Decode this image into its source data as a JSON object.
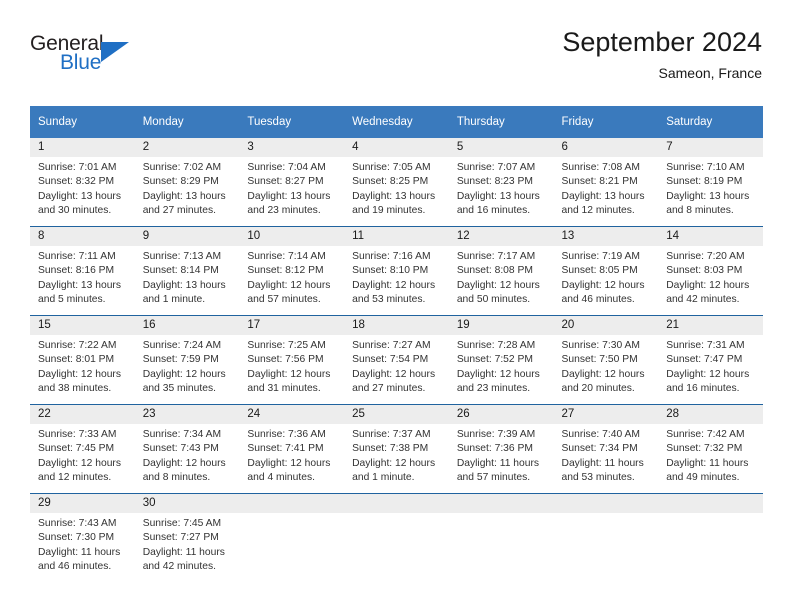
{
  "brand": {
    "name_top": "General",
    "name_bottom": "Blue",
    "color_primary": "#1f6fc4",
    "color_text": "#231f20",
    "triangle_icon": "triangle-icon"
  },
  "header": {
    "title": "September 2024",
    "subtitle": "Sameon, France"
  },
  "colors": {
    "header_row_bg": "#3a7abd",
    "daynum_band_bg": "#ededed",
    "row_separator": "#20639f",
    "page_bg": "#ffffff"
  },
  "weekdays": [
    "Sunday",
    "Monday",
    "Tuesday",
    "Wednesday",
    "Thursday",
    "Friday",
    "Saturday"
  ],
  "weeks": [
    [
      {
        "day": "1",
        "sunrise": "Sunrise: 7:01 AM",
        "sunset": "Sunset: 8:32 PM",
        "daylight_line1": "Daylight: 13 hours",
        "daylight_line2": "and 30 minutes."
      },
      {
        "day": "2",
        "sunrise": "Sunrise: 7:02 AM",
        "sunset": "Sunset: 8:29 PM",
        "daylight_line1": "Daylight: 13 hours",
        "daylight_line2": "and 27 minutes."
      },
      {
        "day": "3",
        "sunrise": "Sunrise: 7:04 AM",
        "sunset": "Sunset: 8:27 PM",
        "daylight_line1": "Daylight: 13 hours",
        "daylight_line2": "and 23 minutes."
      },
      {
        "day": "4",
        "sunrise": "Sunrise: 7:05 AM",
        "sunset": "Sunset: 8:25 PM",
        "daylight_line1": "Daylight: 13 hours",
        "daylight_line2": "and 19 minutes."
      },
      {
        "day": "5",
        "sunrise": "Sunrise: 7:07 AM",
        "sunset": "Sunset: 8:23 PM",
        "daylight_line1": "Daylight: 13 hours",
        "daylight_line2": "and 16 minutes."
      },
      {
        "day": "6",
        "sunrise": "Sunrise: 7:08 AM",
        "sunset": "Sunset: 8:21 PM",
        "daylight_line1": "Daylight: 13 hours",
        "daylight_line2": "and 12 minutes."
      },
      {
        "day": "7",
        "sunrise": "Sunrise: 7:10 AM",
        "sunset": "Sunset: 8:19 PM",
        "daylight_line1": "Daylight: 13 hours",
        "daylight_line2": "and 8 minutes."
      }
    ],
    [
      {
        "day": "8",
        "sunrise": "Sunrise: 7:11 AM",
        "sunset": "Sunset: 8:16 PM",
        "daylight_line1": "Daylight: 13 hours",
        "daylight_line2": "and 5 minutes."
      },
      {
        "day": "9",
        "sunrise": "Sunrise: 7:13 AM",
        "sunset": "Sunset: 8:14 PM",
        "daylight_line1": "Daylight: 13 hours",
        "daylight_line2": "and 1 minute."
      },
      {
        "day": "10",
        "sunrise": "Sunrise: 7:14 AM",
        "sunset": "Sunset: 8:12 PM",
        "daylight_line1": "Daylight: 12 hours",
        "daylight_line2": "and 57 minutes."
      },
      {
        "day": "11",
        "sunrise": "Sunrise: 7:16 AM",
        "sunset": "Sunset: 8:10 PM",
        "daylight_line1": "Daylight: 12 hours",
        "daylight_line2": "and 53 minutes."
      },
      {
        "day": "12",
        "sunrise": "Sunrise: 7:17 AM",
        "sunset": "Sunset: 8:08 PM",
        "daylight_line1": "Daylight: 12 hours",
        "daylight_line2": "and 50 minutes."
      },
      {
        "day": "13",
        "sunrise": "Sunrise: 7:19 AM",
        "sunset": "Sunset: 8:05 PM",
        "daylight_line1": "Daylight: 12 hours",
        "daylight_line2": "and 46 minutes."
      },
      {
        "day": "14",
        "sunrise": "Sunrise: 7:20 AM",
        "sunset": "Sunset: 8:03 PM",
        "daylight_line1": "Daylight: 12 hours",
        "daylight_line2": "and 42 minutes."
      }
    ],
    [
      {
        "day": "15",
        "sunrise": "Sunrise: 7:22 AM",
        "sunset": "Sunset: 8:01 PM",
        "daylight_line1": "Daylight: 12 hours",
        "daylight_line2": "and 38 minutes."
      },
      {
        "day": "16",
        "sunrise": "Sunrise: 7:24 AM",
        "sunset": "Sunset: 7:59 PM",
        "daylight_line1": "Daylight: 12 hours",
        "daylight_line2": "and 35 minutes."
      },
      {
        "day": "17",
        "sunrise": "Sunrise: 7:25 AM",
        "sunset": "Sunset: 7:56 PM",
        "daylight_line1": "Daylight: 12 hours",
        "daylight_line2": "and 31 minutes."
      },
      {
        "day": "18",
        "sunrise": "Sunrise: 7:27 AM",
        "sunset": "Sunset: 7:54 PM",
        "daylight_line1": "Daylight: 12 hours",
        "daylight_line2": "and 27 minutes."
      },
      {
        "day": "19",
        "sunrise": "Sunrise: 7:28 AM",
        "sunset": "Sunset: 7:52 PM",
        "daylight_line1": "Daylight: 12 hours",
        "daylight_line2": "and 23 minutes."
      },
      {
        "day": "20",
        "sunrise": "Sunrise: 7:30 AM",
        "sunset": "Sunset: 7:50 PM",
        "daylight_line1": "Daylight: 12 hours",
        "daylight_line2": "and 20 minutes."
      },
      {
        "day": "21",
        "sunrise": "Sunrise: 7:31 AM",
        "sunset": "Sunset: 7:47 PM",
        "daylight_line1": "Daylight: 12 hours",
        "daylight_line2": "and 16 minutes."
      }
    ],
    [
      {
        "day": "22",
        "sunrise": "Sunrise: 7:33 AM",
        "sunset": "Sunset: 7:45 PM",
        "daylight_line1": "Daylight: 12 hours",
        "daylight_line2": "and 12 minutes."
      },
      {
        "day": "23",
        "sunrise": "Sunrise: 7:34 AM",
        "sunset": "Sunset: 7:43 PM",
        "daylight_line1": "Daylight: 12 hours",
        "daylight_line2": "and 8 minutes."
      },
      {
        "day": "24",
        "sunrise": "Sunrise: 7:36 AM",
        "sunset": "Sunset: 7:41 PM",
        "daylight_line1": "Daylight: 12 hours",
        "daylight_line2": "and 4 minutes."
      },
      {
        "day": "25",
        "sunrise": "Sunrise: 7:37 AM",
        "sunset": "Sunset: 7:38 PM",
        "daylight_line1": "Daylight: 12 hours",
        "daylight_line2": "and 1 minute."
      },
      {
        "day": "26",
        "sunrise": "Sunrise: 7:39 AM",
        "sunset": "Sunset: 7:36 PM",
        "daylight_line1": "Daylight: 11 hours",
        "daylight_line2": "and 57 minutes."
      },
      {
        "day": "27",
        "sunrise": "Sunrise: 7:40 AM",
        "sunset": "Sunset: 7:34 PM",
        "daylight_line1": "Daylight: 11 hours",
        "daylight_line2": "and 53 minutes."
      },
      {
        "day": "28",
        "sunrise": "Sunrise: 7:42 AM",
        "sunset": "Sunset: 7:32 PM",
        "daylight_line1": "Daylight: 11 hours",
        "daylight_line2": "and 49 minutes."
      }
    ],
    [
      {
        "day": "29",
        "sunrise": "Sunrise: 7:43 AM",
        "sunset": "Sunset: 7:30 PM",
        "daylight_line1": "Daylight: 11 hours",
        "daylight_line2": "and 46 minutes."
      },
      {
        "day": "30",
        "sunrise": "Sunrise: 7:45 AM",
        "sunset": "Sunset: 7:27 PM",
        "daylight_line1": "Daylight: 11 hours",
        "daylight_line2": "and 42 minutes."
      },
      {
        "day": "",
        "sunrise": "",
        "sunset": "",
        "daylight_line1": "",
        "daylight_line2": ""
      },
      {
        "day": "",
        "sunrise": "",
        "sunset": "",
        "daylight_line1": "",
        "daylight_line2": ""
      },
      {
        "day": "",
        "sunrise": "",
        "sunset": "",
        "daylight_line1": "",
        "daylight_line2": ""
      },
      {
        "day": "",
        "sunrise": "",
        "sunset": "",
        "daylight_line1": "",
        "daylight_line2": ""
      },
      {
        "day": "",
        "sunrise": "",
        "sunset": "",
        "daylight_line1": "",
        "daylight_line2": ""
      }
    ]
  ]
}
